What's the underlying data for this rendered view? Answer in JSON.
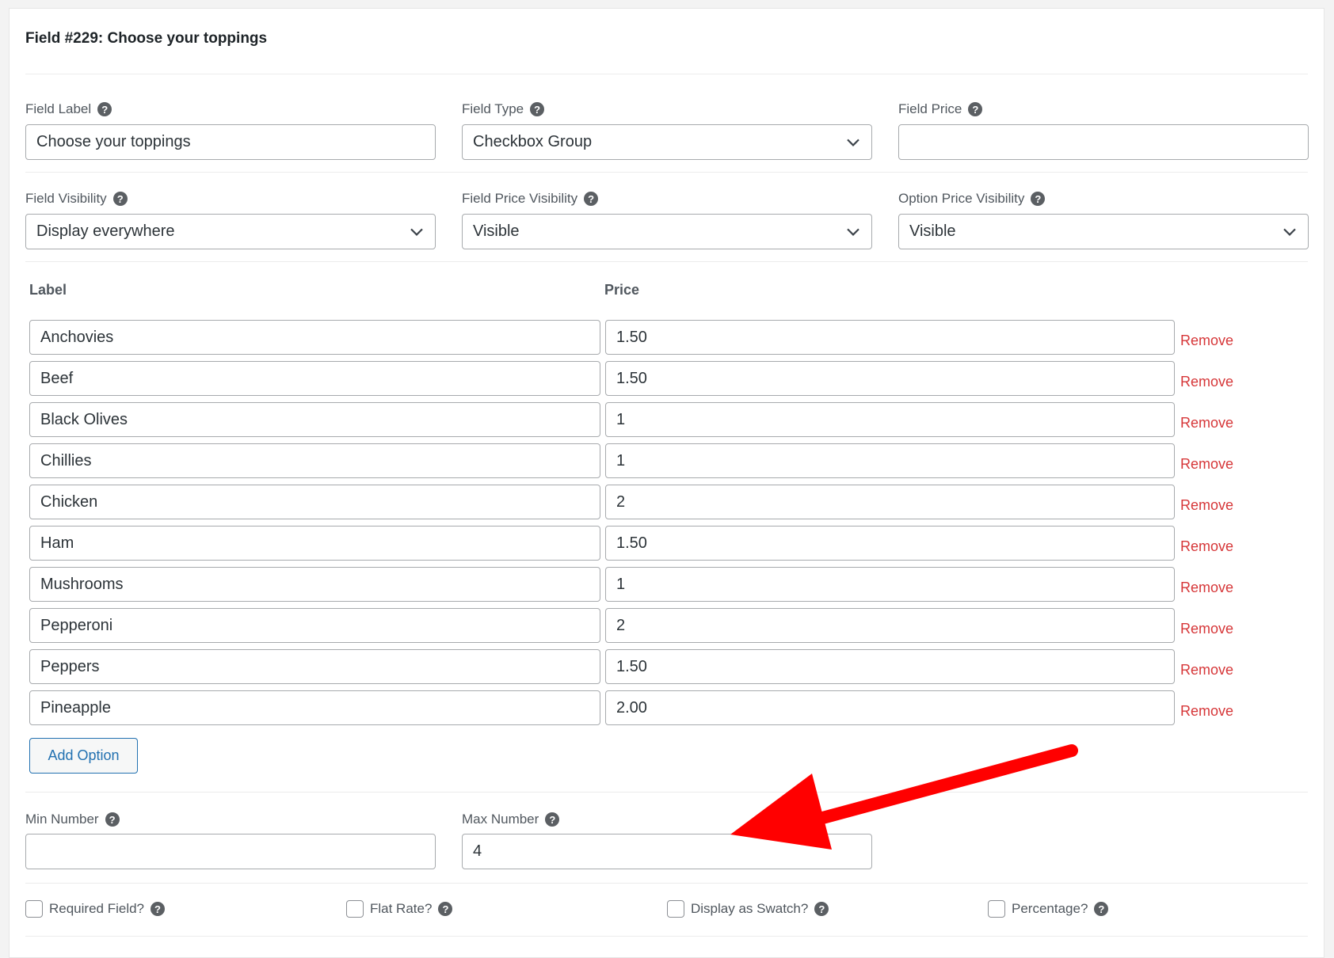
{
  "header": {
    "title": "Field #229: Choose your toppings"
  },
  "fields_row1": {
    "field_label": {
      "label": "Field Label",
      "value": "Choose your toppings"
    },
    "field_type": {
      "label": "Field Type",
      "value": "Checkbox Group"
    },
    "field_price": {
      "label": "Field Price",
      "value": ""
    }
  },
  "fields_row2": {
    "field_visibility": {
      "label": "Field Visibility",
      "value": "Display everywhere"
    },
    "field_price_visibility": {
      "label": "Field Price Visibility",
      "value": "Visible"
    },
    "option_price_visibility": {
      "label": "Option Price Visibility",
      "value": "Visible"
    }
  },
  "options": {
    "label_header": "Label",
    "price_header": "Price",
    "remove_label": "Remove",
    "add_label": "Add Option",
    "rows": [
      {
        "label": "Anchovies",
        "price": "1.50"
      },
      {
        "label": "Beef",
        "price": "1.50"
      },
      {
        "label": "Black Olives",
        "price": "1"
      },
      {
        "label": "Chillies",
        "price": "1"
      },
      {
        "label": "Chicken",
        "price": "2"
      },
      {
        "label": "Ham",
        "price": "1.50"
      },
      {
        "label": "Mushrooms",
        "price": "1"
      },
      {
        "label": "Pepperoni",
        "price": "2"
      },
      {
        "label": "Peppers",
        "price": "1.50"
      },
      {
        "label": "Pineapple",
        "price": "2.00"
      }
    ]
  },
  "limits": {
    "min_number": {
      "label": "Min Number",
      "value": ""
    },
    "max_number": {
      "label": "Max Number",
      "value": "4"
    }
  },
  "checkboxes": [
    {
      "label": "Required Field?",
      "checked": false
    },
    {
      "label": "Flat Rate?",
      "checked": false
    },
    {
      "label": "Display as Swatch?",
      "checked": false
    },
    {
      "label": "Percentage?",
      "checked": false
    }
  ],
  "help_icon_glyph": "?",
  "colors": {
    "remove": "#d63638",
    "button_accent": "#2271b1",
    "annotation_arrow": "#ff0000"
  },
  "annotation": {
    "type": "arrow",
    "points_to": "max-number-input"
  }
}
